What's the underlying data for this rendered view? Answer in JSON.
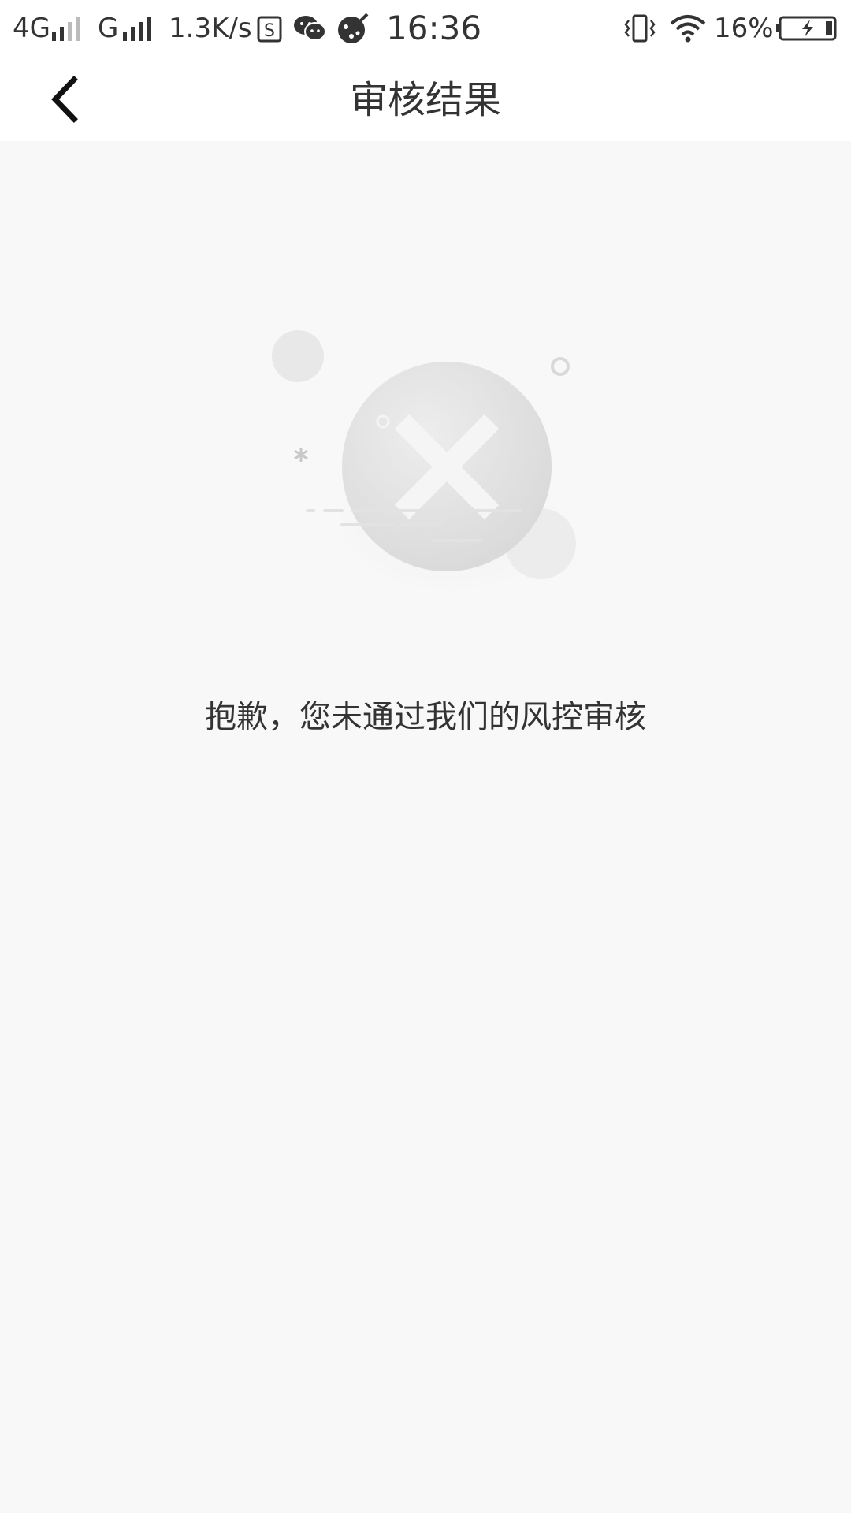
{
  "status_bar": {
    "network_type_1": "4G",
    "network_type_2": "G",
    "speed": "1.3K/s",
    "time": "16:36",
    "battery_percent": "16%",
    "icons": [
      "signal-icon",
      "sim-icon",
      "wechat-icon",
      "paint-app-icon",
      "vibrate-icon",
      "wifi-icon",
      "battery-charging-icon"
    ]
  },
  "nav": {
    "title": "审核结果",
    "back_icon": "chevron-left-icon"
  },
  "result": {
    "icon": "fail-x-icon",
    "message": "抱歉，您未通过我们的风控审核"
  },
  "colors": {
    "background": "#f8f8f8",
    "bar_background": "#ffffff",
    "text": "#333333",
    "illustration_gray": "#e0e0e0"
  }
}
